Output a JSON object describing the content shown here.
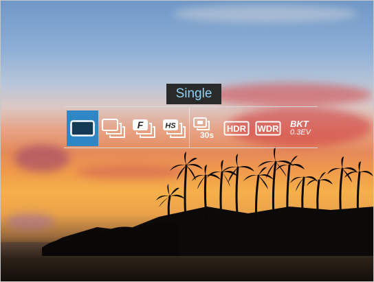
{
  "mode_label": "Single",
  "menu": {
    "options": [
      {
        "icon": "single-shot-icon",
        "selected": true
      },
      {
        "icon": "continuous-shot-icon",
        "selected": false
      },
      {
        "icon": "fast-continuous-icon",
        "text": "F",
        "selected": false
      },
      {
        "icon": "high-speed-continuous-icon",
        "text": "HS",
        "selected": false
      },
      {
        "icon": "interval-timer-icon",
        "text": "30s",
        "selected": false
      },
      {
        "icon": "hdr-icon",
        "text": "HDR",
        "selected": false
      },
      {
        "icon": "wdr-icon",
        "text": "WDR",
        "selected": false
      },
      {
        "icon": "bracketing-icon",
        "text_line1": "BKT",
        "text_line2": "0.3EV",
        "selected": false
      }
    ]
  },
  "colors": {
    "selected": "#2f86c4",
    "label_bg": "#2a2a2a",
    "label_text": "#8fd0f0"
  }
}
